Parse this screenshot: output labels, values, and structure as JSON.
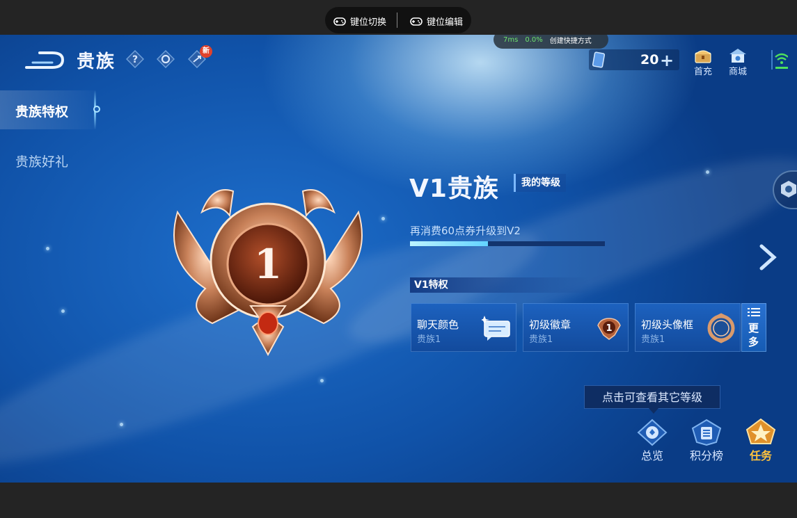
{
  "toolbar": {
    "keymap_switch": "键位切换",
    "keymap_edit": "键位编辑"
  },
  "perf": {
    "latency": "7ms",
    "loss": "0.0%",
    "shortcut": "创建快捷方式"
  },
  "header": {
    "title": "贵族",
    "new_badge": "新"
  },
  "sidebar": {
    "items": [
      {
        "label": "贵族特权"
      },
      {
        "label": "贵族好礼"
      }
    ]
  },
  "currency": {
    "value": "20",
    "plus": "+"
  },
  "topnav": {
    "first_charge": "首充",
    "shop": "商城"
  },
  "medal": {
    "number": "1"
  },
  "level": {
    "title": "V1贵族",
    "my_level_tag": "我的等级",
    "upgrade_text": "再消费60点券升级到V2",
    "progress": 0.4
  },
  "privileges": {
    "title": "V1特权",
    "cards": [
      {
        "name": "聊天颜色",
        "sub": "贵族1"
      },
      {
        "name": "初级徽章",
        "sub": "贵族1"
      },
      {
        "name": "初级头像框",
        "sub": "贵族1"
      }
    ],
    "more_l1": "更",
    "more_l2": "多",
    "badge_number": "1"
  },
  "tooltip": "点击可查看其它等级",
  "bottom_nav": {
    "overview": "总览",
    "ranking": "积分榜",
    "tasks": "任务"
  },
  "colors": {
    "accent_gold": "#ffc23d",
    "progress": "#62d3ff",
    "bg_blue": "#1052a8"
  }
}
